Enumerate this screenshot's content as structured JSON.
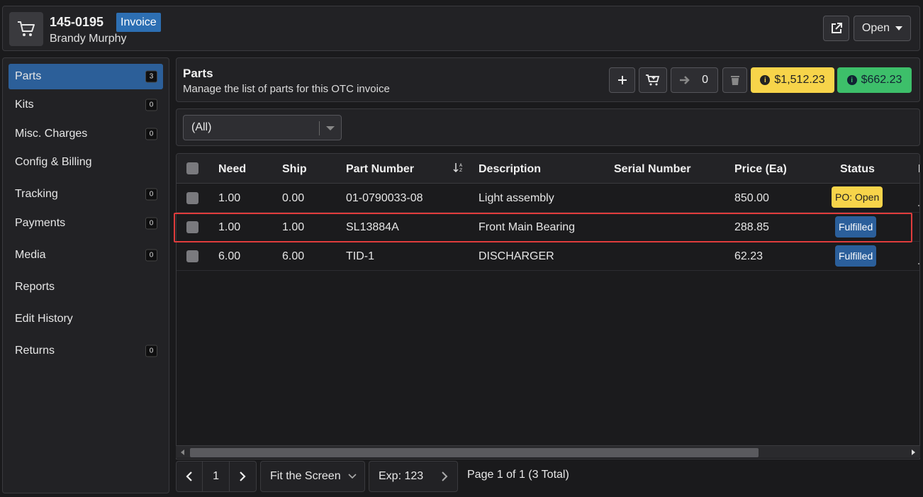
{
  "header": {
    "invoice_number": "145-0195",
    "type_badge": "Invoice",
    "customer": "Brandy Murphy",
    "status_dropdown": "Open"
  },
  "sidebar": {
    "items": [
      {
        "label": "Parts",
        "count": "3"
      },
      {
        "label": "Kits",
        "count": "0"
      },
      {
        "label": "Misc. Charges",
        "count": "0"
      },
      {
        "label": "Config & Billing",
        "count": ""
      },
      {
        "label": "Tracking",
        "count": "0"
      },
      {
        "label": "Payments",
        "count": "0"
      },
      {
        "label": "Media",
        "count": "0"
      },
      {
        "label": "Reports",
        "count": ""
      },
      {
        "label": "Edit History",
        "count": ""
      },
      {
        "label": "Returns",
        "count": "0"
      }
    ]
  },
  "parts_header": {
    "title": "Parts",
    "subtitle": "Manage the list of parts for this OTC invoice",
    "transfer_count": "0",
    "total_yellow": "$1,512.23",
    "total_green": "$662.23"
  },
  "filter": {
    "selected": "(All)"
  },
  "grid": {
    "columns": [
      "Need",
      "Ship",
      "Part Number",
      "Description",
      "Serial Number",
      "Price (Ea)",
      "Status"
    ],
    "rows": [
      {
        "need": "1.00",
        "ship": "0.00",
        "part": "01-0790033-08",
        "desc": "Light assembly",
        "serial": "",
        "price": "850.00",
        "status": "PO: Open"
      },
      {
        "need": "1.00",
        "ship": "1.00",
        "part": "SL13884A",
        "desc": "Front Main Bearing",
        "serial": "",
        "price": "288.85",
        "status": "Fulfilled"
      },
      {
        "need": "6.00",
        "ship": "6.00",
        "part": "TID-1",
        "desc": "DISCHARGER",
        "serial": "",
        "price": "62.23",
        "status": "Fulfilled"
      }
    ]
  },
  "pager": {
    "page": "1",
    "fit": "Fit the Screen",
    "exp": "Exp: 123",
    "summary": "Page 1 of 1 (3 Total)"
  },
  "colors": {
    "accent": "#2c5f99",
    "yellow": "#f7d44a",
    "green": "#3dbf6a",
    "highlight": "#e03c3c"
  }
}
